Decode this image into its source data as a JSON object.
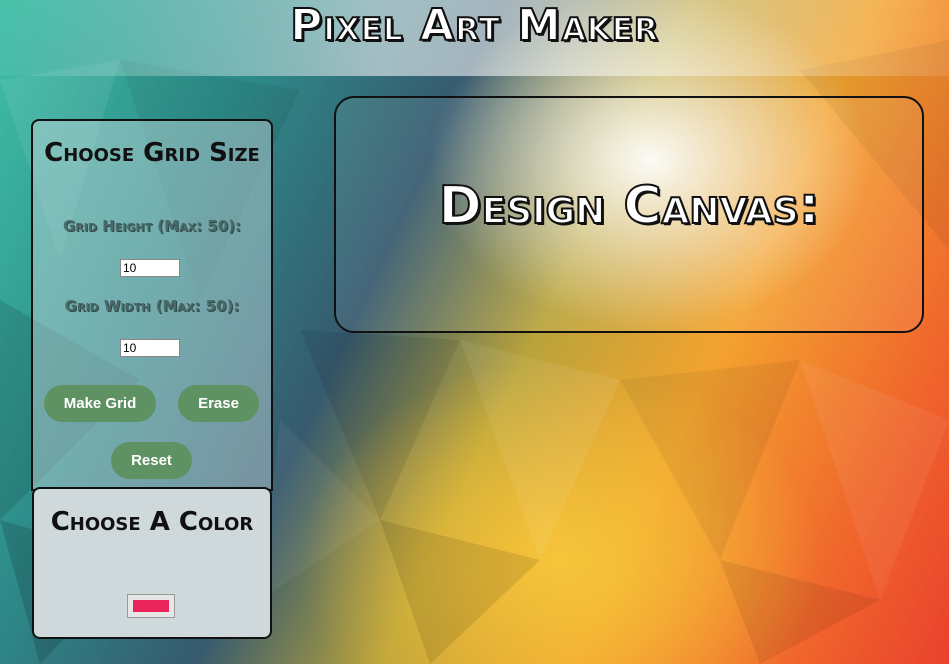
{
  "header": {
    "title": "Pixel Art Maker"
  },
  "grid_panel": {
    "heading": "Choose Grid Size",
    "height_label": "Grid Height (Max: 50):",
    "height_value": "10",
    "width_label": "Grid Width (Max: 50):",
    "width_value": "10",
    "make_grid_label": "Make Grid",
    "erase_label": "Erase",
    "reset_label": "Reset"
  },
  "color_panel": {
    "heading": "Choose A Color",
    "selected_color": "#e8245a"
  },
  "canvas": {
    "title": "Design Canvas:"
  },
  "colors": {
    "button_green": "#5f9263"
  }
}
